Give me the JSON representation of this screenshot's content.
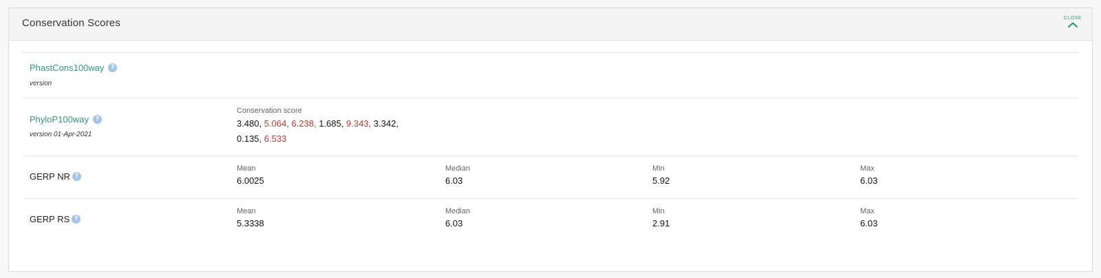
{
  "panel": {
    "title": "Conservation Scores",
    "close_label": "CLOSE"
  },
  "phastcons": {
    "name": "PhastCons100way",
    "version": "version"
  },
  "phylop": {
    "name": "PhyloP100way",
    "version": "version 01-Apr-2021",
    "score_label": "Conservation score",
    "scores": [
      {
        "text": "3.480,",
        "high": false
      },
      {
        "text": "5.064,",
        "high": true
      },
      {
        "text": "6.238,",
        "high": true
      },
      {
        "text": "1.685,",
        "high": false
      },
      {
        "text": "9.343,",
        "high": true
      },
      {
        "text": "3.342,",
        "high": false
      },
      {
        "text": "0.135,",
        "high": false
      },
      {
        "text": "6.533",
        "high": true
      }
    ]
  },
  "gerp_nr": {
    "name": "GERP NR",
    "mean_label": "Mean",
    "mean": "6.0025",
    "median_label": "Median",
    "median": "6.03",
    "min_label": "Min",
    "min": "5.92",
    "max_label": "Max",
    "max": "6.03"
  },
  "gerp_rs": {
    "name": "GERP RS",
    "mean_label": "Mean",
    "mean": "5.3338",
    "median_label": "Median",
    "median": "6.03",
    "min_label": "Min",
    "min": "2.91",
    "max_label": "Max",
    "max": "6.03"
  },
  "colors": {
    "link": "#2d9b7a",
    "high_score": "#c8382b",
    "help_icon": "#a4c4ea"
  }
}
